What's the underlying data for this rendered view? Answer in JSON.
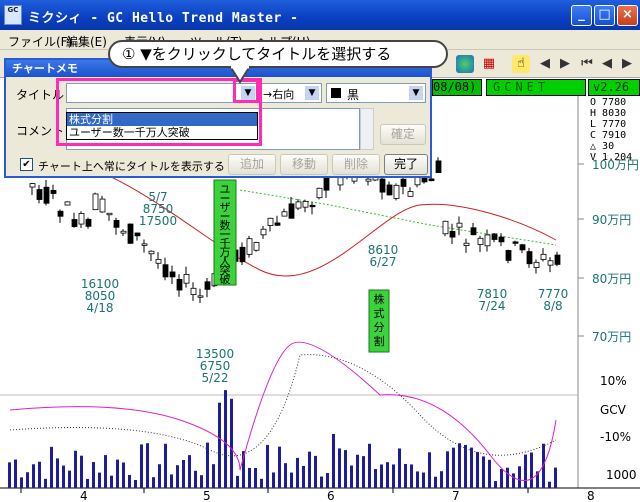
{
  "window": {
    "title": "ミクシィ - GC Hello Trend Master -",
    "icon_text": "GC",
    "minimize_icon": "minimize-icon",
    "maximize_icon": "maximize-icon",
    "close_icon": "close-icon"
  },
  "menu": [
    "ファイル(F)",
    "編集(E)",
    "表示(V)",
    "ツール(T)",
    "ヘルプ(H)"
  ],
  "hint": {
    "text": "① ▼をクリックしてタイトルを選択する"
  },
  "infobar": {
    "date": "08/08)",
    "code": "GCNET",
    "version": "v2.26"
  },
  "ohlc": {
    "O": "7780",
    "H": "8030",
    "L": "7770",
    "C": "7910",
    "change": "30",
    "V": "1.204"
  },
  "dialog": {
    "title": "チャートメモ",
    "title_label": "タイトル",
    "comment_label": "コメント",
    "title_value": "",
    "direction_value": "→右向",
    "color_value": "黒",
    "options": [
      "株式分割",
      "ユーザー数一千万人突破"
    ],
    "selected_option": "株式分割",
    "confirm_button": "確定",
    "checkbox_label": "チャート上へ常にタイトルを表示する",
    "add_button": "追加",
    "move_button": "移動",
    "delete_button": "削除",
    "done_button": "完了"
  },
  "chart_data": {
    "type": "candlestick",
    "y_ticks": [
      "100万円",
      "90万円",
      "80万円",
      "70万円"
    ],
    "indicator_ticks": [
      "10%",
      "GCV",
      "-10%"
    ],
    "volume_tick": "1000",
    "x_ticks": [
      "4",
      "5",
      "6",
      "7",
      "8"
    ],
    "annotations": [
      {
        "lines": [
          "5/7",
          "8750",
          "17500"
        ]
      },
      {
        "lines": [
          "16100",
          "8050",
          "4/18"
        ]
      },
      {
        "lines": [
          "13500",
          "6750",
          "5/22"
        ]
      },
      {
        "lines": [
          "8610",
          "6/27"
        ]
      },
      {
        "lines": [
          "7810",
          "7/24"
        ]
      },
      {
        "lines": [
          "7770",
          "8/8"
        ]
      }
    ],
    "memos": [
      {
        "text": "ユーザー数一千万人突破"
      },
      {
        "text": "株式分割"
      }
    ]
  }
}
